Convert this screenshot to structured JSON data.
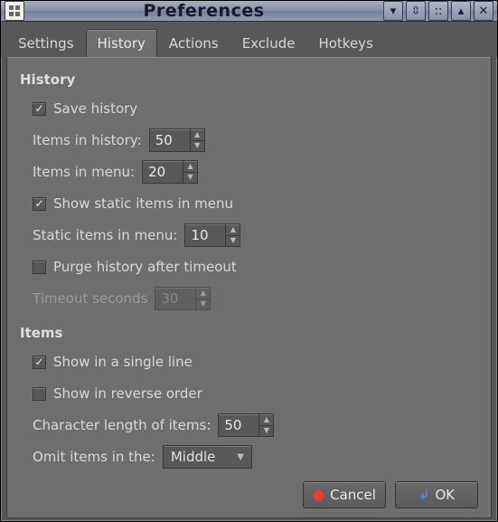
{
  "window": {
    "title": "Preferences"
  },
  "tabs": [
    {
      "label": "Settings",
      "active": false
    },
    {
      "label": "History",
      "active": true
    },
    {
      "label": "Actions",
      "active": false
    },
    {
      "label": "Exclude",
      "active": false
    },
    {
      "label": "Hotkeys",
      "active": false
    }
  ],
  "sections": {
    "history": {
      "title": "History",
      "save_history": {
        "label": "Save history",
        "checked": true
      },
      "items_in_history": {
        "label": "Items in history:",
        "value": "50"
      },
      "items_in_menu": {
        "label": "Items in menu:",
        "value": "20"
      },
      "show_static": {
        "label": "Show static items in menu",
        "checked": true
      },
      "static_items_in_menu": {
        "label": "Static items in menu:",
        "value": "10"
      },
      "purge_after_timeout": {
        "label": "Purge history after timeout",
        "checked": false
      },
      "timeout_seconds": {
        "label": "Timeout seconds",
        "value": "30",
        "disabled": true
      }
    },
    "items": {
      "title": "Items",
      "single_line": {
        "label": "Show in a single line",
        "checked": true
      },
      "reverse_order": {
        "label": "Show in reverse order",
        "checked": false
      },
      "char_length": {
        "label": "Character length of items:",
        "value": "50"
      },
      "omit": {
        "label": "Omit items in the:",
        "selected": "Middle"
      }
    }
  },
  "buttons": {
    "cancel": "Cancel",
    "ok": "OK"
  }
}
